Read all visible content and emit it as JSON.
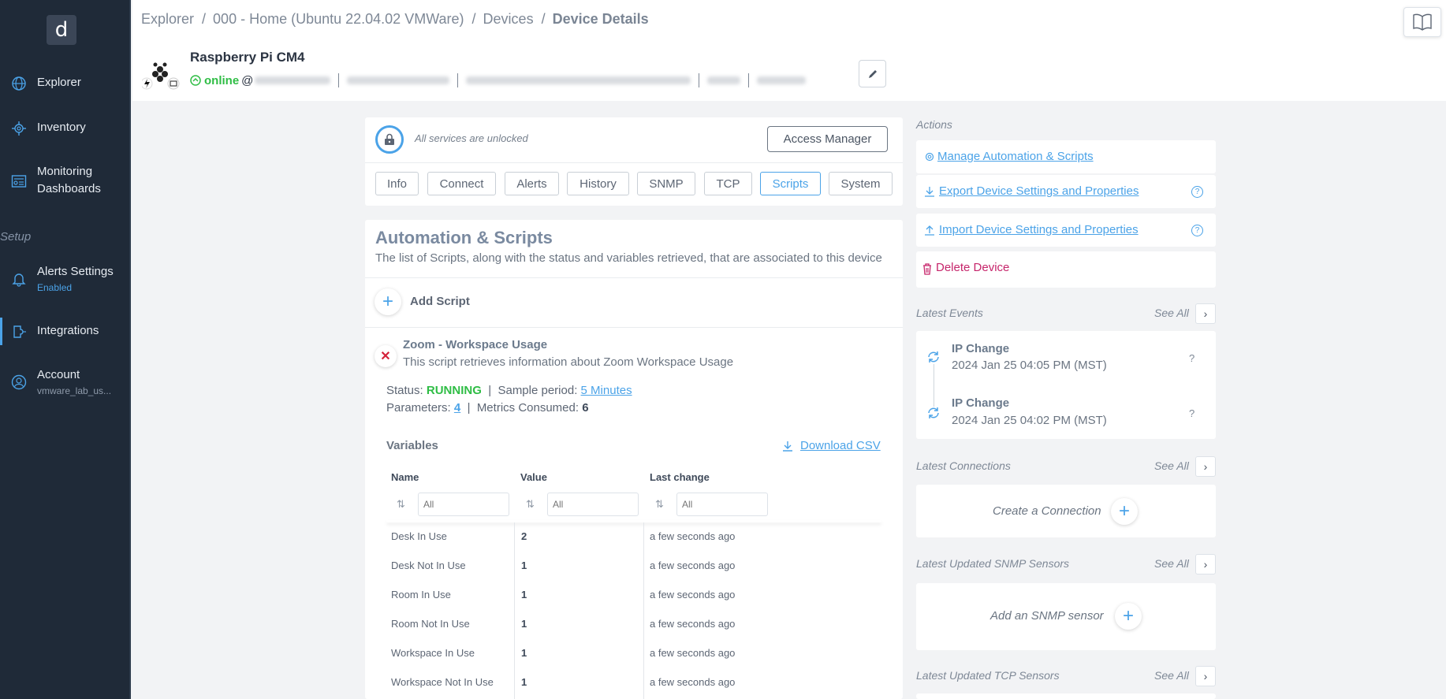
{
  "sidebar": {
    "logo": "d",
    "items": [
      {
        "label": "Explorer",
        "icon": "globe-icon"
      },
      {
        "label": "Inventory",
        "icon": "gear-network-icon"
      },
      {
        "label": "Monitoring",
        "label2": "Dashboards",
        "icon": "dashboard-icon"
      },
      {
        "label": "Alerts Settings",
        "sub": "Enabled",
        "icon": "bell-icon"
      },
      {
        "label": "Integrations",
        "icon": "plug-icon"
      },
      {
        "label": "Account",
        "sub": "vmware_lab_us...",
        "icon": "user-icon"
      }
    ],
    "section_setup": "Setup"
  },
  "breadcrumb": {
    "items": [
      "Explorer",
      "000 - Home (Ubuntu 22.04.02 VMWare)",
      "Devices"
    ],
    "current": "Device Details",
    "separator": "/"
  },
  "device": {
    "name": "Raspberry Pi CM4",
    "status": "online",
    "at": "@"
  },
  "lock": {
    "text": "All services are unlocked",
    "access_button": "Access Manager"
  },
  "tabs": [
    "Info",
    "Connect",
    "Alerts",
    "History",
    "SNMP",
    "TCP",
    "Scripts",
    "System"
  ],
  "active_tab": "Scripts",
  "automation": {
    "title": "Automation & Scripts",
    "description": "The list of Scripts, along with the status and variables retrieved, that are associated to this device",
    "add_script": "Add Script"
  },
  "script": {
    "name": "Zoom - Workspace Usage",
    "description": "This script retrieves information about Zoom Workspace Usage",
    "status_label": "Status:",
    "status": "RUNNING",
    "sample_label": "Sample period:",
    "sample_period": "5 Minutes",
    "params_label": "Parameters:",
    "params": "4",
    "metrics_label": "Metrics Consumed:",
    "metrics": "6",
    "pipe": "|"
  },
  "variables": {
    "title": "Variables",
    "download": "Download CSV",
    "columns": [
      "Name",
      "Value",
      "Last change"
    ],
    "filter_placeholder": "All",
    "rows": [
      {
        "name": "Desk In Use",
        "value": "2",
        "changed": "a few seconds ago"
      },
      {
        "name": "Desk Not In Use",
        "value": "1",
        "changed": "a few seconds ago"
      },
      {
        "name": "Room In Use",
        "value": "1",
        "changed": "a few seconds ago"
      },
      {
        "name": "Room Not In Use",
        "value": "1",
        "changed": "a few seconds ago"
      },
      {
        "name": "Workspace In Use",
        "value": "1",
        "changed": "a few seconds ago"
      },
      {
        "name": "Workspace Not In Use",
        "value": "1",
        "changed": "a few seconds ago"
      }
    ]
  },
  "actions": {
    "title": "Actions",
    "manage": "Manage Automation & Scripts",
    "export": "Export Device Settings and Properties",
    "import": "Import Device Settings and Properties",
    "delete": "Delete Device"
  },
  "events": {
    "title": "Latest Events",
    "see_all": "See All",
    "items": [
      {
        "title": "IP Change",
        "date": "2024 Jan 25 04:05 PM (MST)"
      },
      {
        "title": "IP Change",
        "date": "2024 Jan 25 04:02 PM (MST)"
      }
    ],
    "help": "?"
  },
  "connections": {
    "title": "Latest Connections",
    "see_all": "See All",
    "create": "Create a Connection"
  },
  "snmp": {
    "title": "Latest Updated SNMP Sensors",
    "see_all": "See All",
    "add": "Add an SNMP sensor"
  },
  "tcp": {
    "title": "Latest Updated TCP Sensors",
    "see_all": "See All"
  },
  "colors": {
    "sidebar_bg": "#1f2a38",
    "accent": "#4ba3e8",
    "online": "#2fbd45",
    "danger": "#c6256b"
  }
}
